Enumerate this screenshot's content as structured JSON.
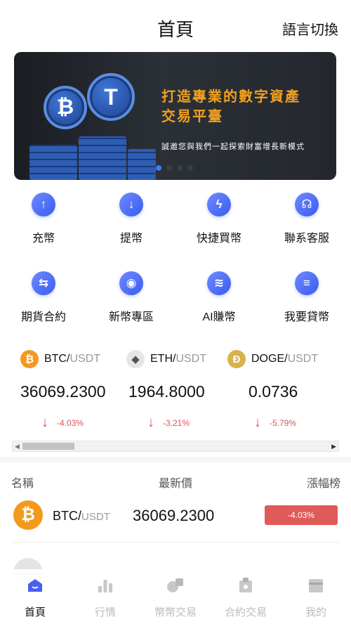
{
  "header": {
    "title": "首頁",
    "lang_switch": "語言切換"
  },
  "banner": {
    "title_line1": "打造專業的數字資產",
    "title_line2": "交易平臺",
    "subtitle": "誠邀您與我們一起探索財富增長新模式",
    "coin_left": "₿",
    "coin_right": "T",
    "slides": 4,
    "active_slide": 1
  },
  "actions": [
    {
      "label": "充幣",
      "icon": "arrow-up-icon",
      "glyph": "↑"
    },
    {
      "label": "提幣",
      "icon": "arrow-down-icon",
      "glyph": "↓"
    },
    {
      "label": "快捷買幣",
      "icon": "lightning-icon",
      "glyph": "ϟ"
    },
    {
      "label": "聯系客服",
      "icon": "headset-icon",
      "glyph": "☊"
    },
    {
      "label": "期貨合約",
      "icon": "exchange-icon",
      "glyph": "⇆"
    },
    {
      "label": "新幣專區",
      "icon": "target-icon",
      "glyph": "◉"
    },
    {
      "label": "AI賺幣",
      "icon": "coins-stack-icon",
      "glyph": "≋"
    },
    {
      "label": "我要貸幣",
      "icon": "loan-icon",
      "glyph": "≡"
    }
  ],
  "tickers": [
    {
      "base": "BTC/",
      "quote": "USDT",
      "price": "36069.2300",
      "change": "-4.03%",
      "icon_glyph": "₿"
    },
    {
      "base": "ETH/",
      "quote": "USDT",
      "price": "1964.8000",
      "change": "-3.21%",
      "icon_glyph": "◆"
    },
    {
      "base": "DOGE/",
      "quote": "USDT",
      "price": "0.0736",
      "change": "-5.79%",
      "icon_glyph": "Ð"
    }
  ],
  "market": {
    "col_name": "名稱",
    "col_price": "最新價",
    "col_change": "漲幅榜",
    "rows": [
      {
        "base": "BTC/",
        "quote": "USDT",
        "price": "36069.2300",
        "change": "-4.03%",
        "icon_glyph": "₿"
      }
    ]
  },
  "nav": [
    {
      "label": "首頁",
      "icon": "home-icon",
      "active": true
    },
    {
      "label": "行情",
      "icon": "chart-icon",
      "active": false
    },
    {
      "label": "幣幣交易",
      "icon": "coin-trade-icon",
      "active": false
    },
    {
      "label": "合約交易",
      "icon": "contract-icon",
      "active": false
    },
    {
      "label": "我的",
      "icon": "wallet-icon",
      "active": false
    }
  ],
  "colors": {
    "accent": "#3c7cf5",
    "down": "#e05a5a",
    "banner_gold": "#f0a020"
  }
}
